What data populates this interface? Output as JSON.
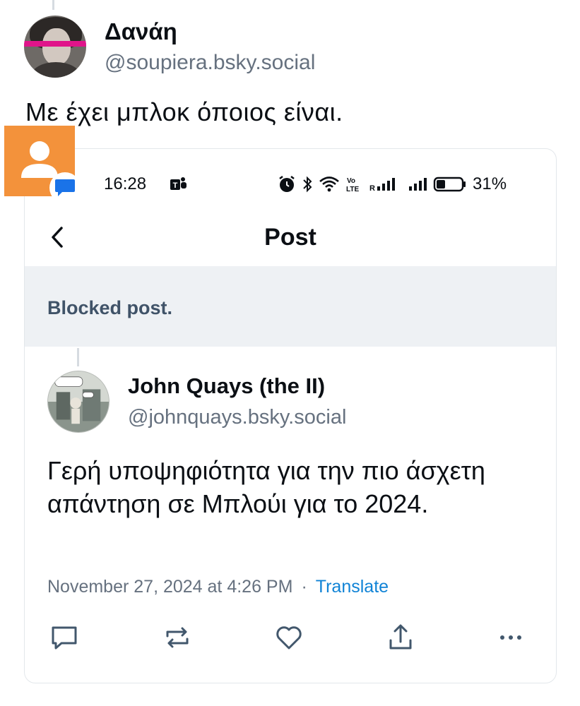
{
  "post": {
    "author_name": "Δανάη",
    "author_handle": "@soupiera.bsky.social",
    "text": "Με έχει μπλοκ όποιος είναι."
  },
  "screenshot": {
    "status_bar": {
      "time": "16:28",
      "battery": "31%"
    },
    "nav": {
      "title": "Post"
    },
    "blocked_label": "Blocked post.",
    "quoted": {
      "author_name": "John Quays (the II)",
      "author_handle": "@johnquays.bsky.social",
      "text": "Γερή υποψηφιότητα για την πιο άσχετη απάντηση σε Μπλούι για το 2024.",
      "date": "November 27, 2024 at 4:26 PM",
      "separator": "·",
      "translate": "Translate"
    }
  },
  "colors": {
    "accent": "#1083d6",
    "muted": "#66717f",
    "blocked_bg": "#eef1f4",
    "contact_badge": "#f3923b"
  },
  "icons": [
    "reply-icon",
    "repost-icon",
    "like-icon",
    "share-icon",
    "more-icon",
    "back-icon",
    "alarm-icon",
    "bluetooth-icon",
    "wifi-icon",
    "signal-icon",
    "battery-icon",
    "teams-icon",
    "contact-icon",
    "messages-icon"
  ]
}
